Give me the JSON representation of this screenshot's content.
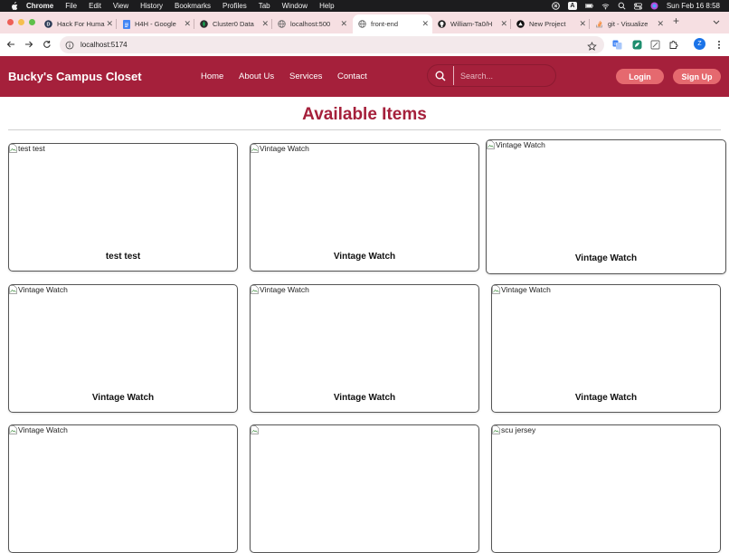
{
  "menubar": {
    "app": "Chrome",
    "menus": [
      "File",
      "Edit",
      "View",
      "History",
      "Bookmarks",
      "Profiles",
      "Tab",
      "Window",
      "Help"
    ],
    "input_source": "A",
    "datetime": "Sun Feb 16  8:58"
  },
  "tabs": [
    {
      "label": "Hack For Huma",
      "icon": "hack-for-humanity-icon"
    },
    {
      "label": "H4H - Google",
      "icon": "google-docs-icon"
    },
    {
      "label": "Cluster0 Data",
      "icon": "mongodb-icon"
    },
    {
      "label": "localhost:500",
      "icon": "globe-icon"
    },
    {
      "label": "front-end",
      "icon": "globe-icon",
      "active": true
    },
    {
      "label": "William-Ta0/H",
      "icon": "github-icon"
    },
    {
      "label": "New Project",
      "icon": "vercel-icon"
    },
    {
      "label": "git - Visualize",
      "icon": "stackoverflow-icon"
    }
  ],
  "toolbar": {
    "url": "localhost:5174",
    "profile_initial": "Z"
  },
  "site": {
    "brand": "Bucky's Campus Closet",
    "nav": [
      "Home",
      "About Us",
      "Services",
      "Contact"
    ],
    "search_placeholder": "Search...",
    "login": "Login",
    "signup": "Sign Up"
  },
  "main": {
    "title": "Available Items",
    "items": [
      {
        "alt": "test test",
        "title": "test test"
      },
      {
        "alt": "Vintage Watch",
        "title": "Vintage Watch"
      },
      {
        "alt": "Vintage Watch",
        "title": "Vintage Watch"
      },
      {
        "alt": "Vintage Watch",
        "title": "Vintage Watch"
      },
      {
        "alt": "Vintage Watch",
        "title": "Vintage Watch"
      },
      {
        "alt": "Vintage Watch",
        "title": "Vintage Watch"
      },
      {
        "alt": "Vintage Watch",
        "title": ""
      },
      {
        "alt": "",
        "title": ""
      },
      {
        "alt": "scu jersey",
        "title": ""
      }
    ]
  },
  "colors": {
    "brand": "#a5203b",
    "button": "#e5696f",
    "tabstrip": "#f6dfe2"
  }
}
